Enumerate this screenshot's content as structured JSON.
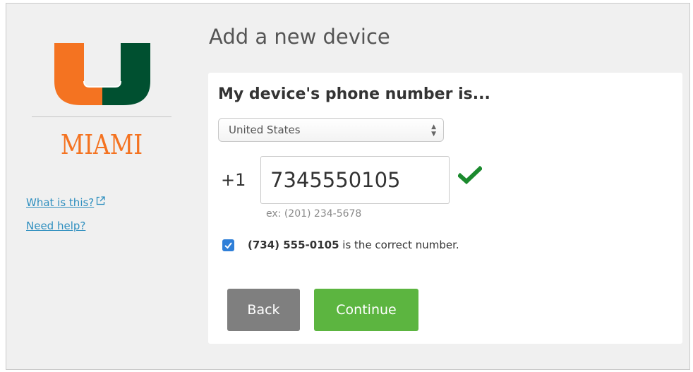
{
  "page": {
    "title": "Add a new device"
  },
  "sidebar": {
    "school_name": "MIAMI",
    "what_is_this": "What is this?",
    "need_help": "Need help?",
    "logo_colors": {
      "orange": "#f47321",
      "green": "#005030"
    }
  },
  "form": {
    "heading": "My device's phone number is...",
    "country": "United States",
    "country_code": "+1",
    "phone_value": "7345550105",
    "example": "ex: (201) 234-5678",
    "confirm_number": "(734) 555-0105",
    "confirm_suffix": " is the correct number.",
    "confirm_checked": true,
    "validation_icon": "check-icon",
    "validation_color": "#1b8a2e"
  },
  "buttons": {
    "back": "Back",
    "continue": "Continue",
    "back_color": "#7f7f7f",
    "continue_color": "#5cb540"
  }
}
